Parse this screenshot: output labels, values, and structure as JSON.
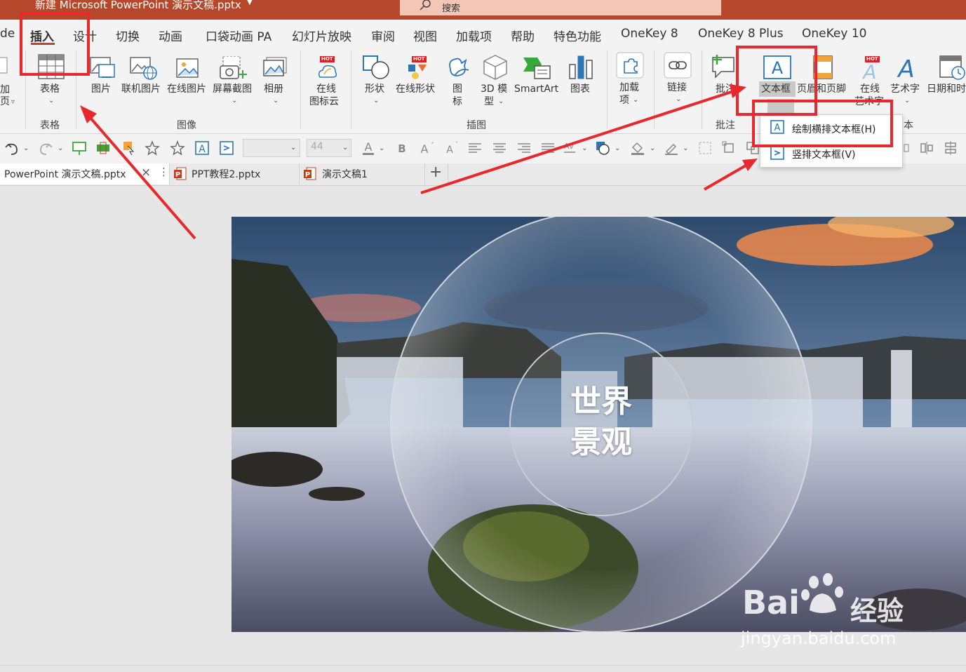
{
  "window": {
    "title": "新建 Microsoft PowerPoint 演示文稿.pptx",
    "search_placeholder": "搜索"
  },
  "menu_tabs": [
    "de",
    "插入",
    "设计",
    "切换",
    "动画",
    "口袋动画 PA",
    "幻灯片放映",
    "审阅",
    "视图",
    "加载项",
    "帮助",
    "特色功能",
    "OneKey 8",
    "OneKey 8 Plus",
    "OneKey 10"
  ],
  "ribbon": {
    "left_cut": [
      "加",
      "页"
    ],
    "table": {
      "label": "表格",
      "group": "表格"
    },
    "images": {
      "items": [
        "图片",
        "联机图片",
        "在线图片",
        "屏幕截图",
        "相册"
      ],
      "group": "图像"
    },
    "online_icons": {
      "line1": "在线",
      "line2": "图标云"
    },
    "illustrations": {
      "shapes": "形状",
      "online_shapes": "在线形状",
      "icons_line1": "图",
      "icons_line2": "标",
      "model_line1": "3D 模",
      "model_line2": "型",
      "smartart": "SmartArt",
      "chart": "图表",
      "group": "插图"
    },
    "addins": {
      "line1": "加载",
      "line2": "项"
    },
    "link": "链接",
    "comment": {
      "label": "批注",
      "group": "批注"
    },
    "text": {
      "textbox": "文本框",
      "header_footer": "页眉和页脚",
      "online_art_line1": "在线",
      "online_art_line2": "艺术字",
      "wordart": "艺术字",
      "datetime": "日期和时",
      "group_cut": "本"
    },
    "hot_badge": "HOT"
  },
  "format_bar": {
    "font_size": "44"
  },
  "doc_tabs": [
    {
      "title": "PowerPoint 演示文稿.pptx"
    },
    {
      "title": "PPT教程2.pptx"
    },
    {
      "title": "演示文稿1"
    }
  ],
  "textbox_menu": {
    "horizontal": "绘制横排文本框(H)",
    "vertical": "竖排文本框(V)"
  },
  "slide": {
    "line1": "世界",
    "line2": "景观"
  },
  "watermark": {
    "brand": "Bai",
    "brand2": "经验",
    "url": "jingyan.baidu.com"
  },
  "colors": {
    "accent": "#b7472a",
    "annotation_red": "#e8282c",
    "ribbon_bg": "#f3f3f3"
  }
}
